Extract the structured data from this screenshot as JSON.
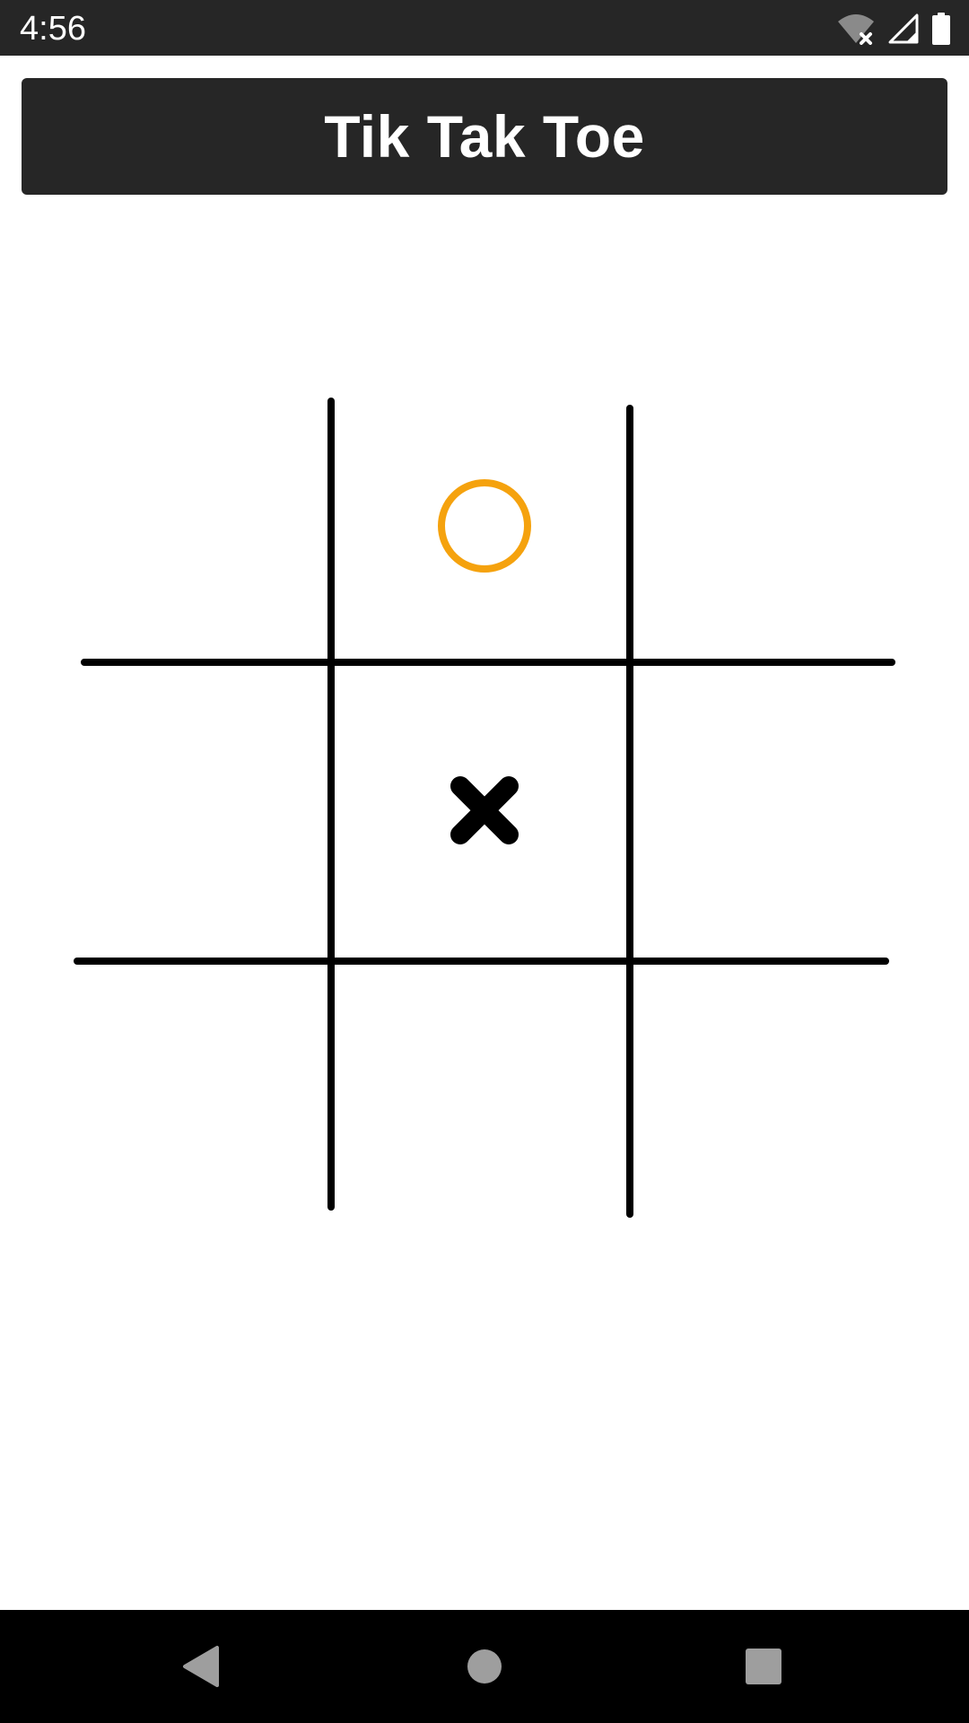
{
  "status_bar": {
    "time": "4:56",
    "icons": [
      "wifi-off-icon",
      "cell-signal-icon",
      "battery-icon"
    ]
  },
  "header": {
    "title": "Tik Tak Toe"
  },
  "board": {
    "cells": [
      [
        "",
        "O",
        ""
      ],
      [
        "",
        "X",
        ""
      ],
      [
        "",
        "",
        ""
      ]
    ],
    "colors": {
      "o_mark": "#F5A20E",
      "x_mark": "#000000",
      "grid": "#000000"
    }
  },
  "nav_bar": {
    "icons": [
      "back-icon",
      "home-icon",
      "recents-icon"
    ]
  },
  "colors": {
    "bar": "#262626",
    "background": "#FFFFFF"
  }
}
